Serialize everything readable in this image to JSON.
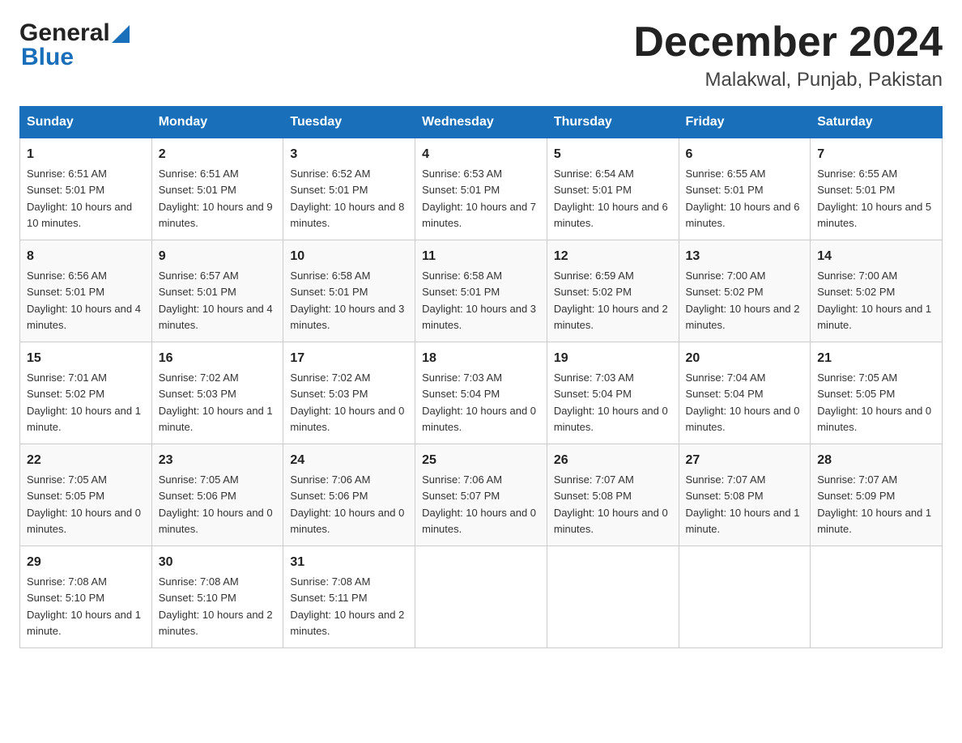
{
  "header": {
    "logo_text_general": "General",
    "logo_text_blue": "Blue",
    "month": "December 2024",
    "location": "Malakwal, Punjab, Pakistan"
  },
  "days_of_week": [
    "Sunday",
    "Monday",
    "Tuesday",
    "Wednesday",
    "Thursday",
    "Friday",
    "Saturday"
  ],
  "weeks": [
    [
      {
        "day": "1",
        "sunrise": "6:51 AM",
        "sunset": "5:01 PM",
        "daylight": "10 hours and 10 minutes."
      },
      {
        "day": "2",
        "sunrise": "6:51 AM",
        "sunset": "5:01 PM",
        "daylight": "10 hours and 9 minutes."
      },
      {
        "day": "3",
        "sunrise": "6:52 AM",
        "sunset": "5:01 PM",
        "daylight": "10 hours and 8 minutes."
      },
      {
        "day": "4",
        "sunrise": "6:53 AM",
        "sunset": "5:01 PM",
        "daylight": "10 hours and 7 minutes."
      },
      {
        "day": "5",
        "sunrise": "6:54 AM",
        "sunset": "5:01 PM",
        "daylight": "10 hours and 6 minutes."
      },
      {
        "day": "6",
        "sunrise": "6:55 AM",
        "sunset": "5:01 PM",
        "daylight": "10 hours and 6 minutes."
      },
      {
        "day": "7",
        "sunrise": "6:55 AM",
        "sunset": "5:01 PM",
        "daylight": "10 hours and 5 minutes."
      }
    ],
    [
      {
        "day": "8",
        "sunrise": "6:56 AM",
        "sunset": "5:01 PM",
        "daylight": "10 hours and 4 minutes."
      },
      {
        "day": "9",
        "sunrise": "6:57 AM",
        "sunset": "5:01 PM",
        "daylight": "10 hours and 4 minutes."
      },
      {
        "day": "10",
        "sunrise": "6:58 AM",
        "sunset": "5:01 PM",
        "daylight": "10 hours and 3 minutes."
      },
      {
        "day": "11",
        "sunrise": "6:58 AM",
        "sunset": "5:01 PM",
        "daylight": "10 hours and 3 minutes."
      },
      {
        "day": "12",
        "sunrise": "6:59 AM",
        "sunset": "5:02 PM",
        "daylight": "10 hours and 2 minutes."
      },
      {
        "day": "13",
        "sunrise": "7:00 AM",
        "sunset": "5:02 PM",
        "daylight": "10 hours and 2 minutes."
      },
      {
        "day": "14",
        "sunrise": "7:00 AM",
        "sunset": "5:02 PM",
        "daylight": "10 hours and 1 minute."
      }
    ],
    [
      {
        "day": "15",
        "sunrise": "7:01 AM",
        "sunset": "5:02 PM",
        "daylight": "10 hours and 1 minute."
      },
      {
        "day": "16",
        "sunrise": "7:02 AM",
        "sunset": "5:03 PM",
        "daylight": "10 hours and 1 minute."
      },
      {
        "day": "17",
        "sunrise": "7:02 AM",
        "sunset": "5:03 PM",
        "daylight": "10 hours and 0 minutes."
      },
      {
        "day": "18",
        "sunrise": "7:03 AM",
        "sunset": "5:04 PM",
        "daylight": "10 hours and 0 minutes."
      },
      {
        "day": "19",
        "sunrise": "7:03 AM",
        "sunset": "5:04 PM",
        "daylight": "10 hours and 0 minutes."
      },
      {
        "day": "20",
        "sunrise": "7:04 AM",
        "sunset": "5:04 PM",
        "daylight": "10 hours and 0 minutes."
      },
      {
        "day": "21",
        "sunrise": "7:05 AM",
        "sunset": "5:05 PM",
        "daylight": "10 hours and 0 minutes."
      }
    ],
    [
      {
        "day": "22",
        "sunrise": "7:05 AM",
        "sunset": "5:05 PM",
        "daylight": "10 hours and 0 minutes."
      },
      {
        "day": "23",
        "sunrise": "7:05 AM",
        "sunset": "5:06 PM",
        "daylight": "10 hours and 0 minutes."
      },
      {
        "day": "24",
        "sunrise": "7:06 AM",
        "sunset": "5:06 PM",
        "daylight": "10 hours and 0 minutes."
      },
      {
        "day": "25",
        "sunrise": "7:06 AM",
        "sunset": "5:07 PM",
        "daylight": "10 hours and 0 minutes."
      },
      {
        "day": "26",
        "sunrise": "7:07 AM",
        "sunset": "5:08 PM",
        "daylight": "10 hours and 0 minutes."
      },
      {
        "day": "27",
        "sunrise": "7:07 AM",
        "sunset": "5:08 PM",
        "daylight": "10 hours and 1 minute."
      },
      {
        "day": "28",
        "sunrise": "7:07 AM",
        "sunset": "5:09 PM",
        "daylight": "10 hours and 1 minute."
      }
    ],
    [
      {
        "day": "29",
        "sunrise": "7:08 AM",
        "sunset": "5:10 PM",
        "daylight": "10 hours and 1 minute."
      },
      {
        "day": "30",
        "sunrise": "7:08 AM",
        "sunset": "5:10 PM",
        "daylight": "10 hours and 2 minutes."
      },
      {
        "day": "31",
        "sunrise": "7:08 AM",
        "sunset": "5:11 PM",
        "daylight": "10 hours and 2 minutes."
      },
      null,
      null,
      null,
      null
    ]
  ]
}
